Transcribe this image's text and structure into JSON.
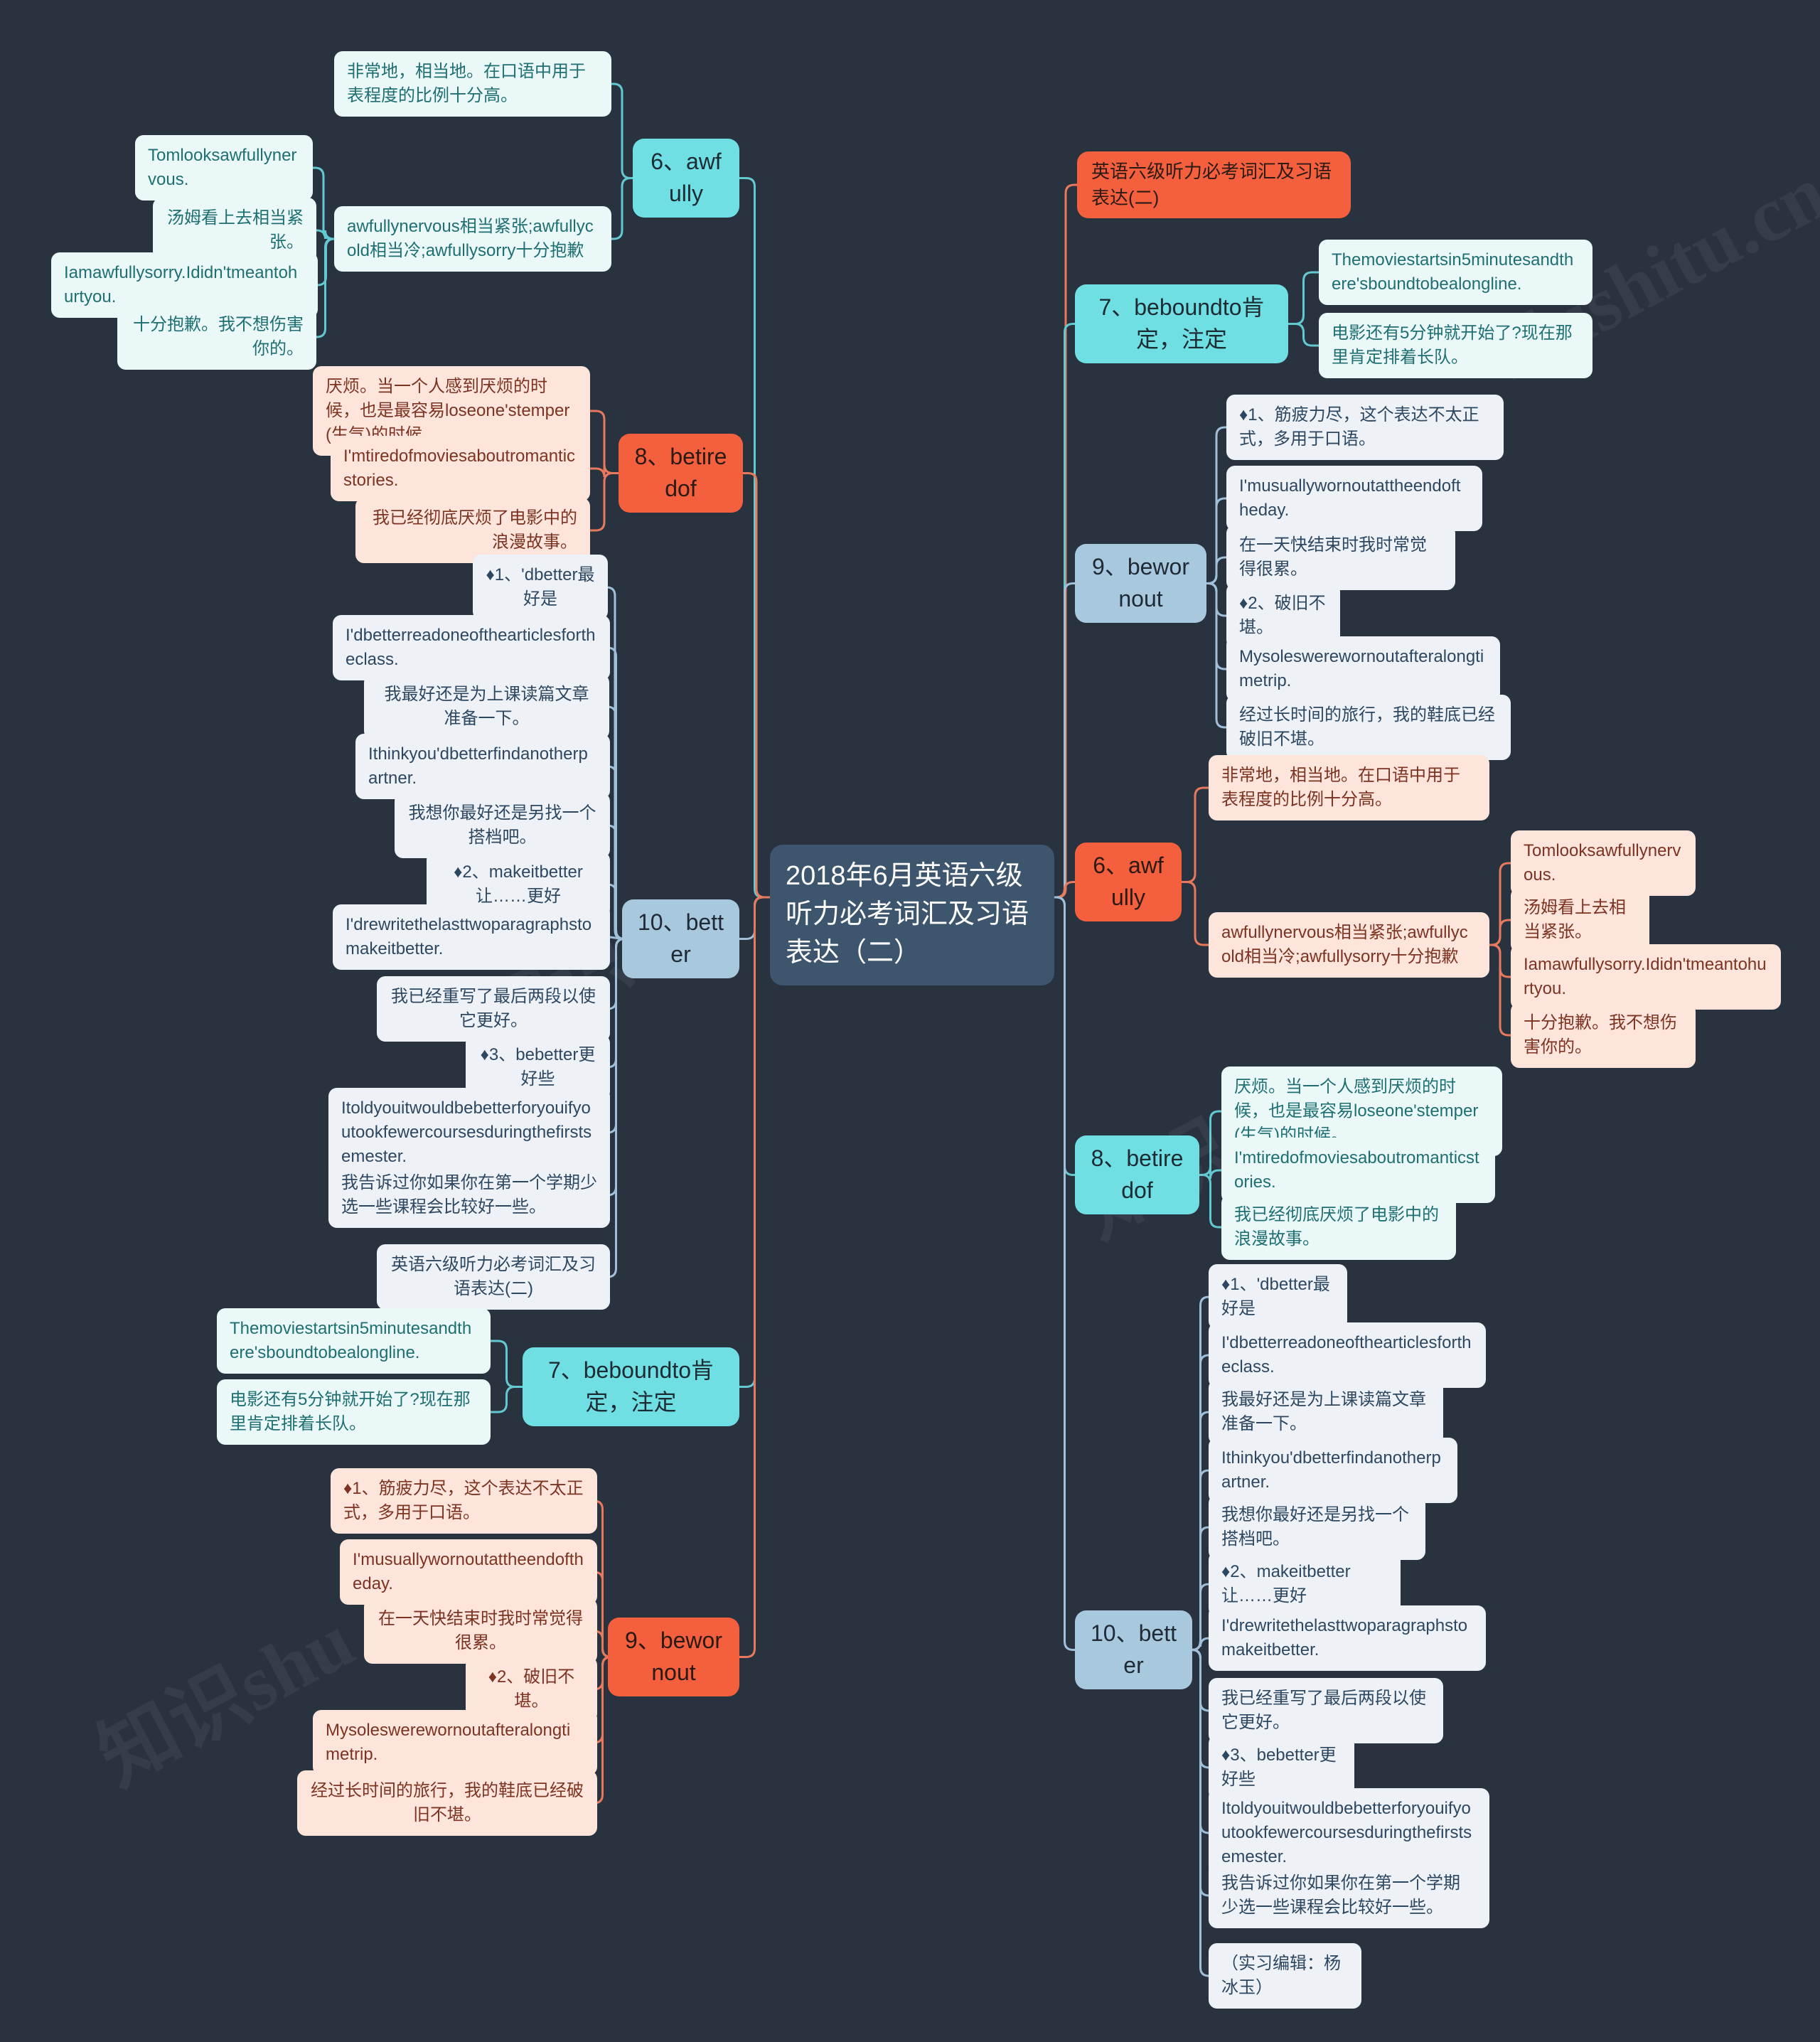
{
  "root": {
    "title": "2018年6月英语六级听力必考词汇及习语表达（二）"
  },
  "watermarks": [
    "知识shu",
    "zhishitu.cn",
    "zhishitu.cn",
    "知识tu",
    "知识shu"
  ],
  "branches": {
    "left": [
      {
        "id": "l-awfully",
        "label": "6、awfully",
        "color": "teal",
        "children": [
          {
            "text": "非常地，相当地。在口语中用于表程度的比例十分高。"
          },
          {
            "text": "awfullynervous相当紧张;awfullycold相当冷;awfullysorry十分抱歉",
            "grandchildren": [
              {
                "text": "Tomlooksawfullynervous."
              },
              {
                "text": "汤姆看上去相当紧张。"
              },
              {
                "text": "Iamawfullysorry.Ididn'tmeantohurtyou."
              },
              {
                "text": "十分抱歉。我不想伤害你的。"
              }
            ]
          }
        ]
      },
      {
        "id": "l-betiredof",
        "label": "8、betiredof",
        "color": "orange",
        "children": [
          {
            "text": "厌烦。当一个人感到厌烦的时候，也是最容易loseone'stemper(生气)的时候。"
          },
          {
            "text": "I'mtiredofmoviesaboutromanticstories."
          },
          {
            "text": "我已经彻底厌烦了电影中的浪漫故事。"
          }
        ]
      },
      {
        "id": "l-better",
        "label": "10、better",
        "color": "blue",
        "children": [
          {
            "text": "♦1、'dbetter最好是"
          },
          {
            "text": "I'dbetterreadoneofthearticlesfortheclass."
          },
          {
            "text": "我最好还是为上课读篇文章准备一下。"
          },
          {
            "text": "Ithinkyou'dbetterfindanotherpartner."
          },
          {
            "text": "我想你最好还是另找一个搭档吧。"
          },
          {
            "text": "♦2、makeitbetter让……更好"
          },
          {
            "text": "I'drewritethelasttwoparagraphstomakeitbetter."
          },
          {
            "text": "我已经重写了最后两段以使它更好。"
          },
          {
            "text": "♦3、bebetter更好些"
          },
          {
            "text": "Itoldyouitwouldbebetterforyouifyoutookfewercoursesduringthefirstsemester."
          },
          {
            "text": "我告诉过你如果你在第一个学期少选一些课程会比较好一些。"
          },
          {
            "text": "英语六级听力必考词汇及习语表达(二)"
          }
        ]
      },
      {
        "id": "l-beboundto",
        "label": "7、beboundto肯定，注定",
        "color": "teal",
        "children": [
          {
            "text": "Themoviestartsin5minutesandthere'sboundtobealongline."
          },
          {
            "text": "电影还有5分钟就开始了?现在那里肯定排着长队。"
          }
        ]
      },
      {
        "id": "l-bewornout",
        "label": "9、bewornout",
        "color": "orange",
        "children": [
          {
            "text": "♦1、筋疲力尽，这个表达不太正式，多用于口语。"
          },
          {
            "text": "I'musuallywornoutattheendoftheday."
          },
          {
            "text": "在一天快结束时我时常觉得很累。"
          },
          {
            "text": "♦2、破旧不堪。"
          },
          {
            "text": "Mysoleswerewornoutafteralongtimetrip."
          },
          {
            "text": "经过长时间的旅行，我的鞋底已经破旧不堪。"
          }
        ]
      }
    ],
    "right": [
      {
        "id": "r-title",
        "label": "英语六级听力必考词汇及习语表达(二)",
        "color": "orange-node"
      },
      {
        "id": "r-beboundto",
        "label": "7、beboundto肯定，注定",
        "color": "teal",
        "children": [
          {
            "text": "Themoviestartsin5minutesandthere'sboundtobealongline."
          },
          {
            "text": "电影还有5分钟就开始了?现在那里肯定排着长队。"
          }
        ]
      },
      {
        "id": "r-bewornout",
        "label": "9、bewornout",
        "color": "blue",
        "children": [
          {
            "text": "♦1、筋疲力尽，这个表达不太正式，多用于口语。"
          },
          {
            "text": "I'musuallywornoutattheendoftheday."
          },
          {
            "text": "在一天快结束时我时常觉得很累。"
          },
          {
            "text": "♦2、破旧不堪。"
          },
          {
            "text": "Mysoleswerewornoutafteralongtimetrip."
          },
          {
            "text": "经过长时间的旅行，我的鞋底已经破旧不堪。"
          }
        ]
      },
      {
        "id": "r-awfully",
        "label": "6、awfully",
        "color": "orange",
        "children": [
          {
            "text": "非常地，相当地。在口语中用于表程度的比例十分高。"
          },
          {
            "text": "awfullynervous相当紧张;awfullycold相当冷;awfullysorry十分抱歉",
            "grandchildren": [
              {
                "text": "Tomlooksawfullynervous."
              },
              {
                "text": "汤姆看上去相当紧张。"
              },
              {
                "text": "Iamawfullysorry.Ididn'tmeantohurtyou."
              },
              {
                "text": "十分抱歉。我不想伤害你的。"
              }
            ]
          }
        ]
      },
      {
        "id": "r-betiredof",
        "label": "8、betiredof",
        "color": "teal",
        "children": [
          {
            "text": "厌烦。当一个人感到厌烦的时候，也是最容易loseone'stemper(生气)的时候。"
          },
          {
            "text": "I'mtiredofmoviesaboutromanticstories."
          },
          {
            "text": "我已经彻底厌烦了电影中的浪漫故事。"
          }
        ]
      },
      {
        "id": "r-better",
        "label": "10、better",
        "color": "blue",
        "children": [
          {
            "text": "♦1、'dbetter最好是"
          },
          {
            "text": "I'dbetterreadoneofthearticlesfortheclass."
          },
          {
            "text": "我最好还是为上课读篇文章准备一下。"
          },
          {
            "text": "Ithinkyou'dbetterfindanotherpartner."
          },
          {
            "text": "我想你最好还是另找一个搭档吧。"
          },
          {
            "text": "♦2、makeitbetter让……更好"
          },
          {
            "text": "I'drewritethelasttwoparagraphstomakeitbetter."
          },
          {
            "text": "我已经重写了最后两段以使它更好。"
          },
          {
            "text": "♦3、bebetter更好些"
          },
          {
            "text": "Itoldyouitwouldbebetterforyouifyoutookfewercoursesduringthefirstsemester."
          },
          {
            "text": "我告诉过你如果你在第一个学期少选一些课程会比较好一些。"
          },
          {
            "text": "（实习编辑：杨冰玉）"
          }
        ]
      }
    ]
  },
  "colors": {
    "background": "#29323f",
    "root": "#3d566e",
    "teal": "#6fdfe3",
    "orange": "#f4603e",
    "blue": "#a8c8dd",
    "leaf_teal": "#eaf9f8",
    "leaf_peach": "#fde5dc",
    "leaf_grayblue": "#eef2f6"
  }
}
